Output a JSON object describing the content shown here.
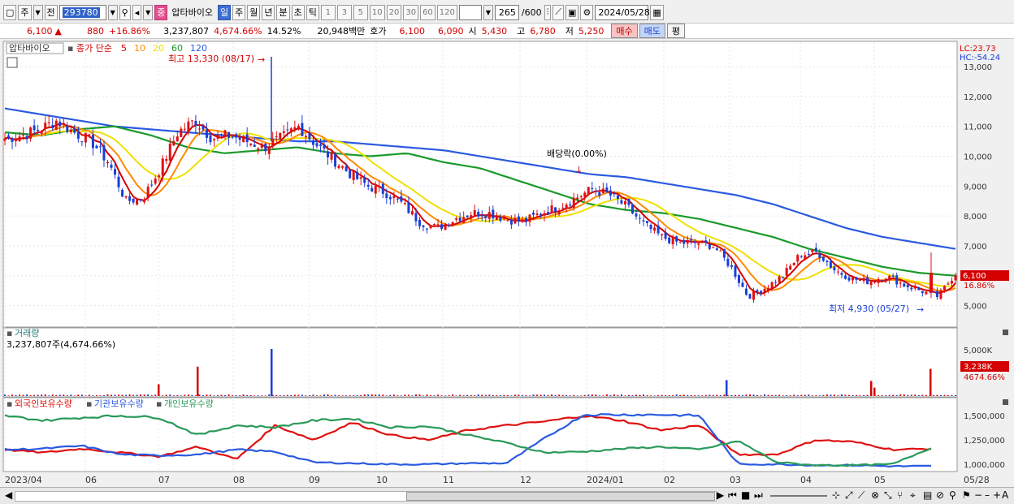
{
  "toolbar": {
    "period_unit": "주",
    "prev_label": "전",
    "stock_code": "293780",
    "stock_name": "압타바이오",
    "name_badge": "중",
    "tabs": [
      "일",
      "주",
      "월",
      "년",
      "분",
      "초",
      "틱"
    ],
    "active_tab": "일",
    "intervals": [
      "1",
      "3",
      "5",
      "10",
      "20",
      "30",
      "60",
      "120"
    ],
    "count": "265",
    "count_total": "/600",
    "date": "2024/05/28"
  },
  "quote": {
    "price": "6,100",
    "change_arrow": "▲",
    "change": "880",
    "change_pct": "+16.86%",
    "volume": "3,237,807",
    "volume_pct": "4,674.66%",
    "turnover_rate": "14.52%",
    "amount": "20,948백만",
    "bid_ask_label": "호가",
    "bid_ask": "6,100",
    "bid_ask2": "6,090",
    "open_label": "시",
    "open": "5,430",
    "high_label": "고",
    "high": "6,780",
    "low_label": "저",
    "low": "5,250",
    "buy_label": "매수",
    "sell_label": "매도",
    "eval_label": "평"
  },
  "price_panel": {
    "name_label": "압타바이오",
    "ma_label": "종가 단순",
    "ma_periods": [
      "5",
      "10",
      "20",
      "60",
      "120"
    ],
    "ma_colors": [
      "#d40000",
      "#ff8a00",
      "#f0e000",
      "#1a9a2a",
      "#2a5ae0"
    ],
    "high_note": "최고 13,330 (08/17)",
    "low_note": "최저 4,930 (05/27)",
    "dividend_note": "배당락(0.00%)",
    "lc": "LC:23.73",
    "hc": "HC:-54.24",
    "y_ticks": [
      "13,000",
      "12,000",
      "11,000",
      "10,000",
      "9,000",
      "8,000",
      "7,000",
      "6,000",
      "5,000"
    ],
    "current_tag": "6,100",
    "current_pct": "16.86%"
  },
  "volume_panel": {
    "title": "거래량",
    "value": "3,237,807주(4,674.66%)",
    "y_tick": "5,000K",
    "current_tag": "3,238K",
    "current_pct": "4674.66%"
  },
  "holding_panel": {
    "series": [
      {
        "name": "외국인보유수량",
        "color": "#e01010"
      },
      {
        "name": "기관보유수량",
        "color": "#2a5ae0"
      },
      {
        "name": "개인보유수량",
        "color": "#2a9a5a"
      }
    ],
    "y_ticks": [
      "1,500,000",
      "1,250,000",
      "1,000,000"
    ]
  },
  "x_axis": {
    "labels": [
      "2023/04",
      "06",
      "07",
      "08",
      "09",
      "10",
      "11",
      "12",
      "2024/01",
      "02",
      "03",
      "04",
      "05",
      "05/28"
    ]
  },
  "chart_data": [
    {
      "type": "candlestick",
      "title": "압타바이오",
      "y_ticks": [
        5000,
        6000,
        7000,
        8000,
        9000,
        10000,
        11000,
        12000,
        13000
      ],
      "ylim": [
        4500,
        13600
      ],
      "x_labels": [
        "2023/04",
        "06",
        "07",
        "08",
        "09",
        "10",
        "11",
        "12",
        "2024/01",
        "02",
        "03",
        "04",
        "05"
      ],
      "close_trend": [
        10600,
        10700,
        10900,
        11200,
        10800,
        10500,
        9800,
        8500,
        8600,
        9600,
        10800,
        11200,
        10600,
        10700,
        10500,
        10300,
        10600,
        11000,
        10400,
        9900,
        9400,
        9000,
        8800,
        8400,
        7800,
        7600,
        7900,
        8100,
        8100,
        7900,
        7800,
        8100,
        8300,
        8600,
        8900,
        8700,
        8300,
        7700,
        7300,
        7100,
        7100,
        7000,
        6300,
        5300,
        5600,
        6000,
        6700,
        6800,
        6200,
        5900,
        5800,
        6000,
        5700,
        5500,
        5300,
        6100
      ],
      "ma120": [
        11600,
        11400,
        11200,
        11000,
        10900,
        10800,
        10700,
        10600,
        10500,
        10500,
        10400,
        10300,
        10200,
        10000,
        9800,
        9600,
        9400,
        9300,
        9100,
        8900,
        8700,
        8400,
        8000,
        7600,
        7300,
        7100,
        6900
      ],
      "ma60": [
        10800,
        10700,
        10900,
        11000,
        10700,
        10300,
        10100,
        10200,
        10300,
        10100,
        10000,
        10100,
        9800,
        9600,
        9200,
        8800,
        8400,
        8200,
        8100,
        7900,
        7600,
        7300,
        6900,
        6600,
        6300,
        6100,
        6000
      ],
      "high_mark": {
        "value": 13330,
        "date": "08/17"
      },
      "low_mark": {
        "value": 4930,
        "date": "05/27"
      },
      "last_close": 6100
    },
    {
      "type": "bar",
      "title": "거래량",
      "last_value_k": 3238,
      "y_tick_k": 5000,
      "spikes_k": [
        1400,
        3500,
        5600,
        1900,
        1800,
        1000,
        3238
      ]
    },
    {
      "type": "line",
      "title": "보유수량",
      "ylim": [
        950000,
        1560000
      ],
      "series": [
        {
          "name": "외국인보유수량",
          "values": [
            1150000,
            1120000,
            1160000,
            1120000,
            1080000,
            1180000,
            1050000,
            1400000,
            1250000,
            1430000,
            1300000,
            1250000,
            1350000,
            1400000,
            1440000,
            1500000,
            1450000,
            1350000,
            1400000,
            1100000,
            1100000,
            1250000,
            1230000,
            1150000,
            1160000
          ]
        },
        {
          "name": "기관보유수량",
          "values": [
            1150000,
            1160000,
            1190000,
            1100000,
            1090000,
            1100000,
            1150000,
            1130000,
            1020000,
            1010000,
            1000000,
            1000000,
            1010000,
            1010000,
            1270000,
            1510000,
            1510000,
            1510000,
            1500000,
            1000000,
            1000000,
            990000,
            990000,
            980000,
            980000
          ]
        },
        {
          "name": "개인보유수량",
          "values": [
            1500000,
            1450000,
            1480000,
            1500000,
            1480000,
            1300000,
            1400000,
            1380000,
            1450000,
            1470000,
            1380000,
            1390000,
            1300000,
            1220000,
            1120000,
            1130000,
            1160000,
            1180000,
            1150000,
            1240000,
            1020000,
            990000,
            990000,
            1000000,
            1170000
          ]
        }
      ]
    }
  ]
}
